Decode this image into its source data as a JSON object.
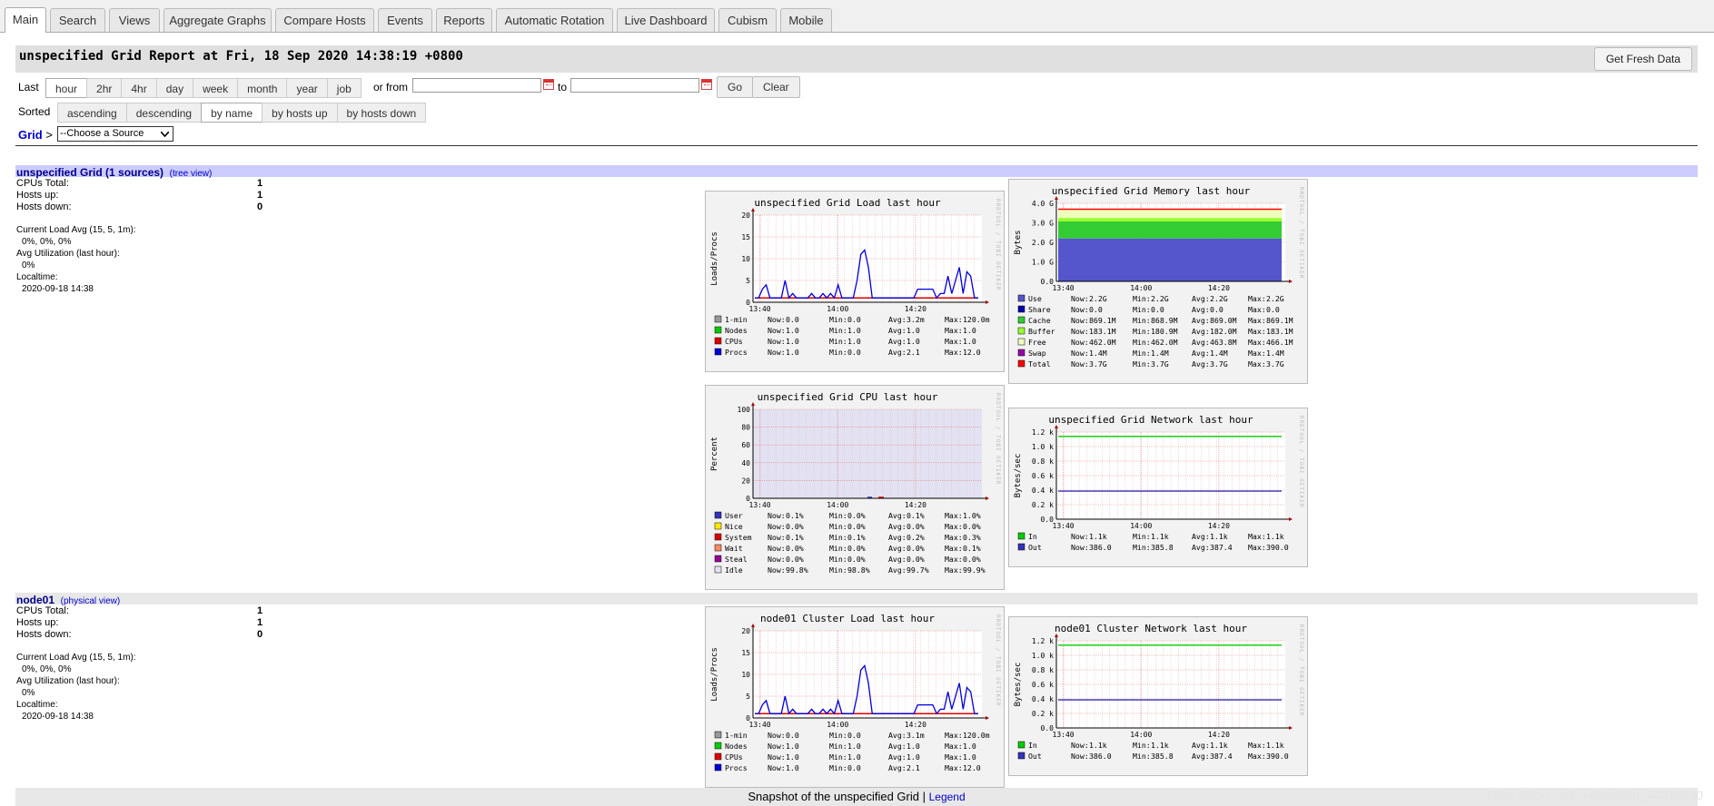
{
  "tabs": [
    {
      "label": "Main",
      "active": true
    },
    {
      "label": "Search"
    },
    {
      "label": "Views"
    },
    {
      "label": "Aggregate Graphs"
    },
    {
      "label": "Compare Hosts"
    },
    {
      "label": "Events"
    },
    {
      "label": "Reports"
    },
    {
      "label": "Automatic Rotation"
    },
    {
      "label": "Live Dashboard"
    },
    {
      "label": "Cubism"
    },
    {
      "label": "Mobile"
    }
  ],
  "header": {
    "title": "unspecified Grid Report at Fri, 18 Sep 2020 14:38:19 +0800",
    "fresh_label": "Get Fresh Data"
  },
  "controls": {
    "last_label": "Last",
    "ranges": [
      "hour",
      "2hr",
      "4hr",
      "day",
      "week",
      "month",
      "year",
      "job"
    ],
    "selected_range": "hour",
    "or_from": "or from",
    "to": "to",
    "from_value": "",
    "to_value": "",
    "go": "Go",
    "clear": "Clear",
    "sorted_label": "Sorted",
    "sorts": [
      "ascending",
      "descending",
      "by name",
      "by hosts up",
      "by hosts down"
    ],
    "selected_sort": "by name",
    "grid_link": "Grid",
    "grid_sep": ">",
    "source_select": "--Choose a Source"
  },
  "clusters": [
    {
      "name": "unspecified Grid (1 sources)",
      "link": "(tree view)",
      "cpus_label": "CPUs Total:",
      "cpus": "1",
      "up_label": "Hosts up:",
      "up": "1",
      "down_label": "Hosts down:",
      "down": "0",
      "load_label": "Current Load Avg (15, 5, 1m):",
      "load": "0%, 0%, 0%",
      "util_label": "Avg Utilization (last hour):",
      "util": "0%",
      "time_label": "Localtime:",
      "time": "2020-09-18 14:38"
    },
    {
      "name": "node01",
      "link": "(physical view)",
      "cpus_label": "CPUs Total:",
      "cpus": "1",
      "up_label": "Hosts up:",
      "up": "1",
      "down_label": "Hosts down:",
      "down": "0",
      "load_label": "Current Load Avg (15, 5, 1m):",
      "load": "0%, 0%, 0%",
      "util_label": "Avg Utilization (last hour):",
      "util": "0%",
      "time_label": "Localtime:",
      "time": "2020-09-18 14:38"
    }
  ],
  "footer": {
    "text": "Snapshot of the unspecified Grid",
    "sep": "|",
    "legend": "Legend"
  },
  "watermark": "https://blog.csdn.net/weixin_44318830",
  "graph_side_text": "RRDTOOL / TOBI OETIKER",
  "chart_data": [
    {
      "id": "grid-load",
      "type": "line",
      "title": "unspecified Grid Load last hour",
      "ylabel": "Loads/Procs",
      "ylim": [
        0,
        20
      ],
      "yticks": [
        "0",
        "5",
        "10",
        "15",
        "20"
      ],
      "xticks": [
        "13:40",
        "14:00",
        "14:20"
      ],
      "series": [
        {
          "name": "1-min",
          "color": "#999999",
          "now": "0.0",
          "min": "0.0",
          "avg": "3.2m",
          "max": "120.0m",
          "values": [
            0,
            0,
            0,
            0,
            0,
            0,
            0,
            0,
            0,
            0,
            0,
            0,
            0,
            0,
            0,
            0,
            0,
            0,
            0,
            0,
            0,
            0,
            0,
            0,
            0,
            0,
            0,
            0,
            0,
            0,
            0,
            0,
            0,
            0,
            0,
            0,
            0,
            0,
            0,
            0,
            0,
            0,
            0,
            0,
            0,
            0,
            0,
            0,
            0,
            0,
            0,
            0,
            0,
            0,
            0,
            0,
            0,
            0,
            0,
            0
          ]
        },
        {
          "name": "Nodes",
          "color": "#00cc00",
          "now": "1.0",
          "min": "1.0",
          "avg": "1.0",
          "max": "1.0",
          "values": [
            1,
            1,
            1,
            1,
            1,
            1,
            1,
            1,
            1,
            1,
            1,
            1,
            1,
            1,
            1,
            1,
            1,
            1,
            1,
            1,
            1,
            1,
            1,
            1,
            1,
            1,
            1,
            1,
            1,
            1,
            1,
            1,
            1,
            1,
            1,
            1,
            1,
            1,
            1,
            1,
            1,
            1,
            1,
            1,
            1,
            1,
            1,
            1,
            1,
            1,
            1,
            1,
            1,
            1,
            1,
            1,
            1,
            1,
            1,
            1
          ]
        },
        {
          "name": "CPUs",
          "color": "#dd0000",
          "now": "1.0",
          "min": "1.0",
          "avg": "1.0",
          "max": "1.0",
          "values": [
            1,
            1,
            1,
            1,
            1,
            1,
            1,
            1,
            1,
            1,
            1,
            1,
            1,
            1,
            1,
            1,
            1,
            1,
            1,
            1,
            1,
            1,
            1,
            1,
            1,
            1,
            1,
            1,
            1,
            1,
            1,
            1,
            1,
            1,
            1,
            1,
            1,
            1,
            1,
            1,
            1,
            1,
            1,
            1,
            1,
            1,
            1,
            1,
            1,
            1,
            1,
            1,
            1,
            1,
            1,
            1,
            1,
            1,
            1,
            1
          ]
        },
        {
          "name": "Procs",
          "color": "#0000dd",
          "now": "1.0",
          "min": "0.0",
          "avg": "2.1",
          "max": "12.0",
          "values": [
            1,
            1,
            3,
            4,
            1,
            1,
            1,
            1,
            5,
            1,
            2,
            1,
            1,
            1,
            1,
            2,
            1,
            1,
            2,
            1,
            2,
            1,
            4,
            1,
            1,
            1,
            1,
            5,
            11,
            12,
            8,
            1,
            1,
            1,
            1,
            1,
            1,
            1,
            1,
            1,
            1,
            1,
            1,
            3,
            3,
            3,
            3,
            3,
            1,
            2,
            2,
            6,
            2,
            5,
            8,
            2,
            7,
            6,
            1,
            1
          ]
        }
      ]
    },
    {
      "id": "grid-memory",
      "type": "area",
      "title": "unspecified Grid Memory last hour",
      "ylabel": "Bytes",
      "ylim": [
        0,
        4.0
      ],
      "yticks": [
        "0.0",
        "1.0 G",
        "2.0 G",
        "3.0 G",
        "4.0 G"
      ],
      "xticks": [
        "13:40",
        "14:00",
        "14:20"
      ],
      "series": [
        {
          "name": "Use",
          "color": "#5555cc",
          "now": "2.2G",
          "min": "2.2G",
          "avg": "2.2G",
          "max": "2.2G",
          "value": 2.2
        },
        {
          "name": "Share",
          "color": "#0000aa",
          "now": "0.0",
          "min": "0.0",
          "avg": "0.0",
          "max": "0.0",
          "value": 0.0
        },
        {
          "name": "Cache",
          "color": "#33cc33",
          "now": "869.1M",
          "min": "868.9M",
          "avg": "869.0M",
          "max": "869.1M",
          "value": 0.869
        },
        {
          "name": "Buffer",
          "color": "#99ff33",
          "now": "183.1M",
          "min": "180.9M",
          "avg": "182.0M",
          "max": "183.1M",
          "value": 0.183
        },
        {
          "name": "Free",
          "color": "#eeffbb",
          "now": "462.0M",
          "min": "462.0M",
          "avg": "463.8M",
          "max": "466.1M",
          "value": 0.462
        },
        {
          "name": "Swap",
          "color": "#9900aa",
          "now": "1.4M",
          "min": "1.4M",
          "avg": "1.4M",
          "max": "1.4M",
          "value": 0.0014
        },
        {
          "name": "Total",
          "color": "#ff0000",
          "now": "3.7G",
          "min": "3.7G",
          "avg": "3.7G",
          "max": "3.7G",
          "value": 3.7
        }
      ]
    },
    {
      "id": "grid-cpu",
      "type": "area",
      "title": "unspecified Grid CPU last hour",
      "ylabel": "Percent",
      "ylim": [
        0,
        100
      ],
      "yticks": [
        "0",
        "20",
        "40",
        "60",
        "80",
        "100"
      ],
      "xticks": [
        "13:40",
        "14:00",
        "14:20"
      ],
      "series": [
        {
          "name": "User",
          "color": "#3333bb",
          "now": "0.1%",
          "min": "0.0%",
          "avg": "0.1%",
          "max": "1.0%"
        },
        {
          "name": "Nice",
          "color": "#ffea00",
          "now": "0.0%",
          "min": "0.0%",
          "avg": "0.0%",
          "max": "0.0%"
        },
        {
          "name": "System",
          "color": "#dd0000",
          "now": "0.1%",
          "min": "0.1%",
          "avg": "0.2%",
          "max": "0.3%"
        },
        {
          "name": "Wait",
          "color": "#ff8a60",
          "now": "0.0%",
          "min": "0.0%",
          "avg": "0.0%",
          "max": "0.1%"
        },
        {
          "name": "Steal",
          "color": "#990099",
          "now": "0.0%",
          "min": "0.0%",
          "avg": "0.0%",
          "max": "0.0%"
        },
        {
          "name": "Idle",
          "color": "#e2e2f2",
          "now": "99.8%",
          "min": "98.8%",
          "avg": "99.7%",
          "max": "99.9%"
        }
      ]
    },
    {
      "id": "grid-network",
      "type": "line",
      "title": "unspecified Grid Network last hour",
      "ylabel": "Bytes/sec",
      "ylim": [
        0,
        1.2
      ],
      "yticks": [
        "0.0",
        "0.2 k",
        "0.4 k",
        "0.6 k",
        "0.8 k",
        "1.0 k",
        "1.2 k"
      ],
      "xticks": [
        "13:40",
        "14:00",
        "14:20"
      ],
      "series": [
        {
          "name": "In",
          "color": "#00cc00",
          "now": "1.1k",
          "min": "1.1k",
          "avg": "1.1k",
          "max": "1.1k",
          "value": 1.14
        },
        {
          "name": "Out",
          "color": "#3333bb",
          "now": "386.0",
          "min": "385.8",
          "avg": "387.4",
          "max": "390.0",
          "value": 0.387
        }
      ]
    },
    {
      "id": "node-load",
      "type": "line",
      "title": "node01 Cluster Load last hour",
      "ylabel": "Loads/Procs",
      "ylim": [
        0,
        20
      ],
      "yticks": [
        "0",
        "5",
        "10",
        "15",
        "20"
      ],
      "xticks": [
        "13:40",
        "14:00",
        "14:20"
      ],
      "series": [
        {
          "name": "1-min",
          "color": "#999999",
          "now": "0.0",
          "min": "0.0",
          "avg": "3.1m",
          "max": "120.0m"
        },
        {
          "name": "Nodes",
          "color": "#00cc00",
          "now": "1.0",
          "min": "1.0",
          "avg": "1.0",
          "max": "1.0"
        },
        {
          "name": "CPUs",
          "color": "#dd0000",
          "now": "1.0",
          "min": "1.0",
          "avg": "1.0",
          "max": "1.0"
        },
        {
          "name": "Procs",
          "color": "#0000dd",
          "now": "1.0",
          "min": "0.0",
          "avg": "2.1",
          "max": "12.0",
          "values": [
            1,
            1,
            3,
            4,
            1,
            1,
            1,
            1,
            5,
            1,
            2,
            1,
            1,
            1,
            1,
            2,
            1,
            1,
            2,
            1,
            2,
            1,
            4,
            1,
            1,
            1,
            1,
            5,
            11,
            12,
            8,
            1,
            1,
            1,
            1,
            1,
            1,
            1,
            1,
            1,
            1,
            1,
            1,
            3,
            3,
            3,
            3,
            3,
            1,
            2,
            2,
            6,
            2,
            5,
            8,
            2,
            7,
            6,
            1,
            1
          ]
        }
      ]
    },
    {
      "id": "node-network",
      "type": "line",
      "title": "node01 Cluster Network last hour",
      "ylabel": "Bytes/sec",
      "ylim": [
        0,
        1.2
      ],
      "yticks": [
        "0.0",
        "0.2 k",
        "0.4 k",
        "0.6 k",
        "0.8 k",
        "1.0 k",
        "1.2 k"
      ],
      "xticks": [
        "13:40",
        "14:00",
        "14:20"
      ],
      "series": [
        {
          "name": "In",
          "color": "#00cc00",
          "now": "1.1k",
          "min": "1.1k",
          "avg": "1.1k",
          "max": "1.1k",
          "value": 1.14
        },
        {
          "name": "Out",
          "color": "#3333bb",
          "now": "386.0",
          "min": "385.8",
          "avg": "387.4",
          "max": "390.0",
          "value": 0.387
        }
      ]
    }
  ]
}
